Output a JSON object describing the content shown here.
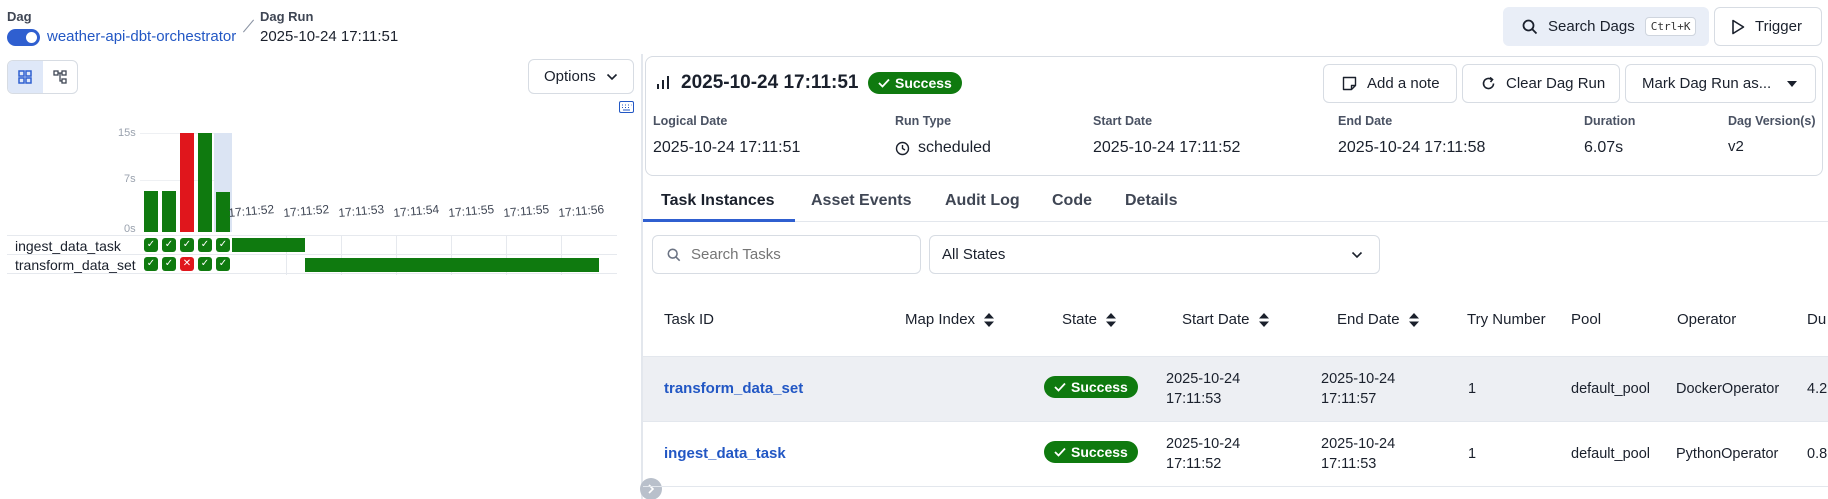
{
  "breadcrumb": {
    "dag_label": "Dag",
    "dag_name": "weather-api-dbt-orchestrator",
    "run_label": "Dag Run",
    "run_value": "2025-10-24 17:11:51"
  },
  "header": {
    "search_label": "Search Dags",
    "search_shortcut": "Ctrl+K",
    "trigger_label": "Trigger"
  },
  "left": {
    "options_label": "Options",
    "y_ticks": [
      "15s",
      "7s",
      "0s"
    ],
    "time_labels": [
      "17:11:52",
      "17:11:52",
      "17:11:53",
      "17:11:54",
      "17:11:55",
      "17:11:55",
      "17:11:56"
    ],
    "tasks": [
      "ingest_data_task",
      "transform_data_set"
    ],
    "run_bars": [
      {
        "duration_s": 6.2,
        "state": "success"
      },
      {
        "duration_s": 6.2,
        "state": "success"
      },
      {
        "duration_s": 15.0,
        "state": "failed"
      },
      {
        "duration_s": 15.0,
        "state": "success"
      },
      {
        "duration_s": 6.07,
        "state": "success",
        "selected": true
      }
    ],
    "state_grid": [
      [
        "success",
        "success",
        "success",
        "success",
        "success"
      ],
      [
        "success",
        "success",
        "failed",
        "success",
        "success"
      ]
    ]
  },
  "run": {
    "title": "2025-10-24 17:11:51",
    "status": "Success",
    "add_note": "Add a note",
    "clear_run": "Clear Dag Run",
    "mark_run": "Mark Dag Run as...",
    "meta": [
      {
        "label": "Logical Date",
        "value": "2025-10-24 17:11:51"
      },
      {
        "label": "Run Type",
        "value": "scheduled"
      },
      {
        "label": "Start Date",
        "value": "2025-10-24 17:11:52"
      },
      {
        "label": "End Date",
        "value": "2025-10-24 17:11:58"
      },
      {
        "label": "Duration",
        "value": "6.07s"
      },
      {
        "label": "Dag Version(s)",
        "value": "v2"
      }
    ]
  },
  "tabs": [
    "Task Instances",
    "Asset Events",
    "Audit Log",
    "Code",
    "Details"
  ],
  "filters": {
    "search_placeholder": "Search Tasks",
    "state_select": "All States"
  },
  "table": {
    "headers": [
      "Task ID",
      "Map Index",
      "State",
      "Start Date",
      "End Date",
      "Try Number",
      "Pool",
      "Operator",
      "Du"
    ],
    "rows": [
      {
        "task_id": "transform_data_set",
        "state": "Success",
        "start_date": "2025-10-24",
        "start_time": "17:11:53",
        "end_date": "2025-10-24",
        "end_time": "17:11:57",
        "try_number": "1",
        "pool": "default_pool",
        "operator": "DockerOperator",
        "duration_cut": "4.2"
      },
      {
        "task_id": "ingest_data_task",
        "state": "Success",
        "start_date": "2025-10-24",
        "start_time": "17:11:52",
        "end_date": "2025-10-24",
        "end_time": "17:11:53",
        "try_number": "1",
        "pool": "default_pool",
        "operator": "PythonOperator",
        "duration_cut": "0.8"
      }
    ]
  },
  "colors": {
    "success": "#0f7a0f",
    "failed": "#e0161c",
    "accent": "#2f5fd0",
    "link": "#2257c4"
  }
}
